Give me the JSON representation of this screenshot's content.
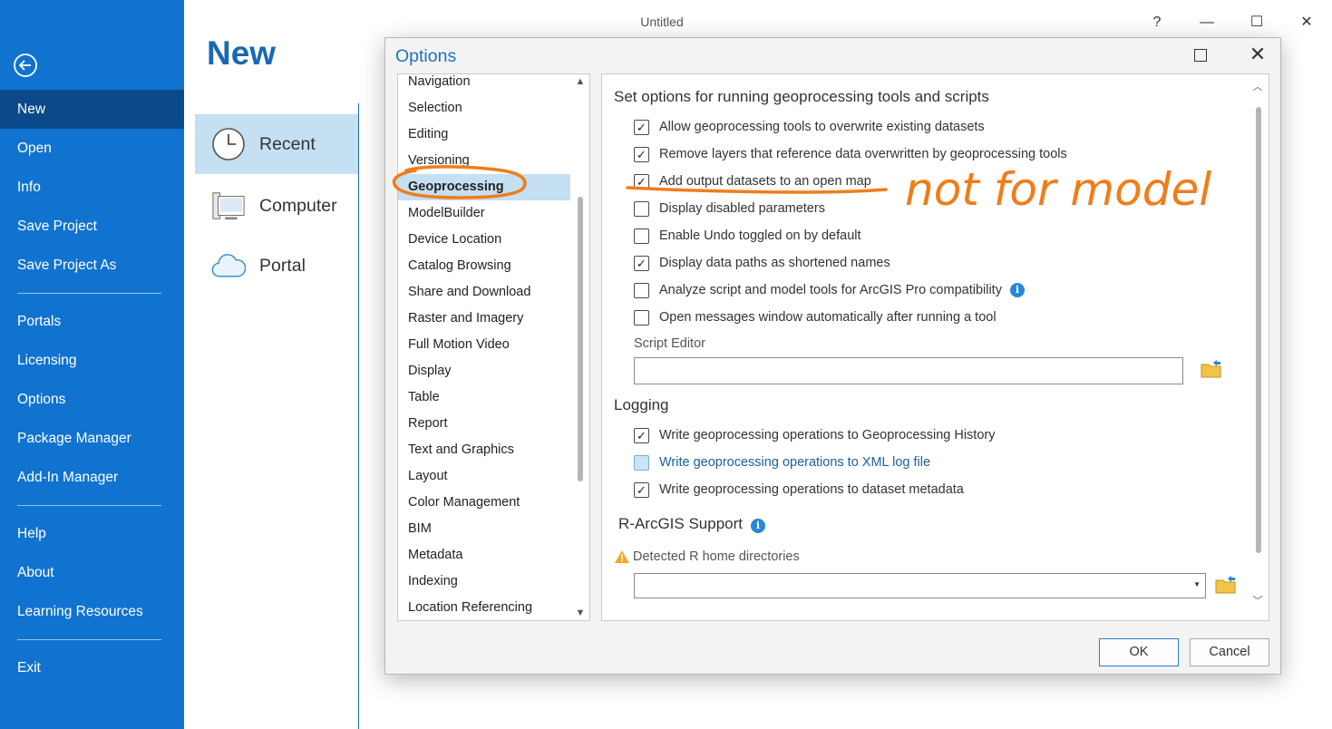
{
  "window": {
    "title": "Untitled",
    "help": "?",
    "minimize": "—",
    "maximize": "☐",
    "close": "✕"
  },
  "sidebar": {
    "items": [
      "New",
      "Open",
      "Info",
      "Save Project",
      "Save Project As",
      "Portals",
      "Licensing",
      "Options",
      "Package Manager",
      "Add-In Manager",
      "Help",
      "About",
      "Learning Resources",
      "Exit"
    ],
    "active": "New"
  },
  "new_page": {
    "heading": "New",
    "items": [
      {
        "label": "Recent",
        "icon": "clock-icon"
      },
      {
        "label": "Computer",
        "icon": "computer-icon"
      },
      {
        "label": "Portal",
        "icon": "cloud-icon"
      }
    ]
  },
  "dialog": {
    "title": "Options",
    "categories": [
      "Navigation",
      "Selection",
      "Editing",
      "Versioning",
      "Geoprocessing",
      "ModelBuilder",
      "Device Location",
      "Catalog Browsing",
      "Share and Download",
      "Raster and Imagery",
      "Full Motion Video",
      "Display",
      "Table",
      "Report",
      "Text and Graphics",
      "Layout",
      "Color Management",
      "BIM",
      "Metadata",
      "Indexing",
      "Location Referencing"
    ],
    "selected_category": "Geoprocessing",
    "settings_heading": "Set options for running geoprocessing tools and scripts",
    "options": [
      {
        "label": "Allow geoprocessing tools to overwrite existing datasets",
        "checked": true
      },
      {
        "label": "Remove layers that reference data overwritten by geoprocessing tools",
        "checked": true
      },
      {
        "label": "Add output datasets to an open map",
        "checked": true
      },
      {
        "label": "Display disabled parameters",
        "checked": false
      },
      {
        "label": "Enable Undo toggled on by default",
        "checked": false
      },
      {
        "label": "Display data paths as shortened names",
        "checked": true
      },
      {
        "label": "Analyze script and model tools for ArcGIS Pro compatibility",
        "checked": false,
        "info": true
      },
      {
        "label": "Open messages window automatically after running a tool",
        "checked": false
      }
    ],
    "script_editor": {
      "label": "Script Editor",
      "value": ""
    },
    "logging": {
      "heading": "Logging",
      "options": [
        {
          "label": "Write geoprocessing operations to Geoprocessing History",
          "checked": true
        },
        {
          "label": "Write geoprocessing operations to XML log file",
          "checked": false,
          "hover": true
        },
        {
          "label": "Write geoprocessing operations to dataset metadata",
          "checked": true
        }
      ]
    },
    "r_support": {
      "heading": "R-ArcGIS Support",
      "detected_label": "Detected R home directories",
      "value": ""
    },
    "ok": "OK",
    "cancel": "Cancel"
  },
  "annotation": {
    "text": "not for model",
    "color": "#f07d1a"
  },
  "colors": {
    "sidebar": "#1173d0",
    "sidebar_active": "#0b4a8a",
    "accent": "#1a73c0",
    "selection": "#c5dff3"
  }
}
